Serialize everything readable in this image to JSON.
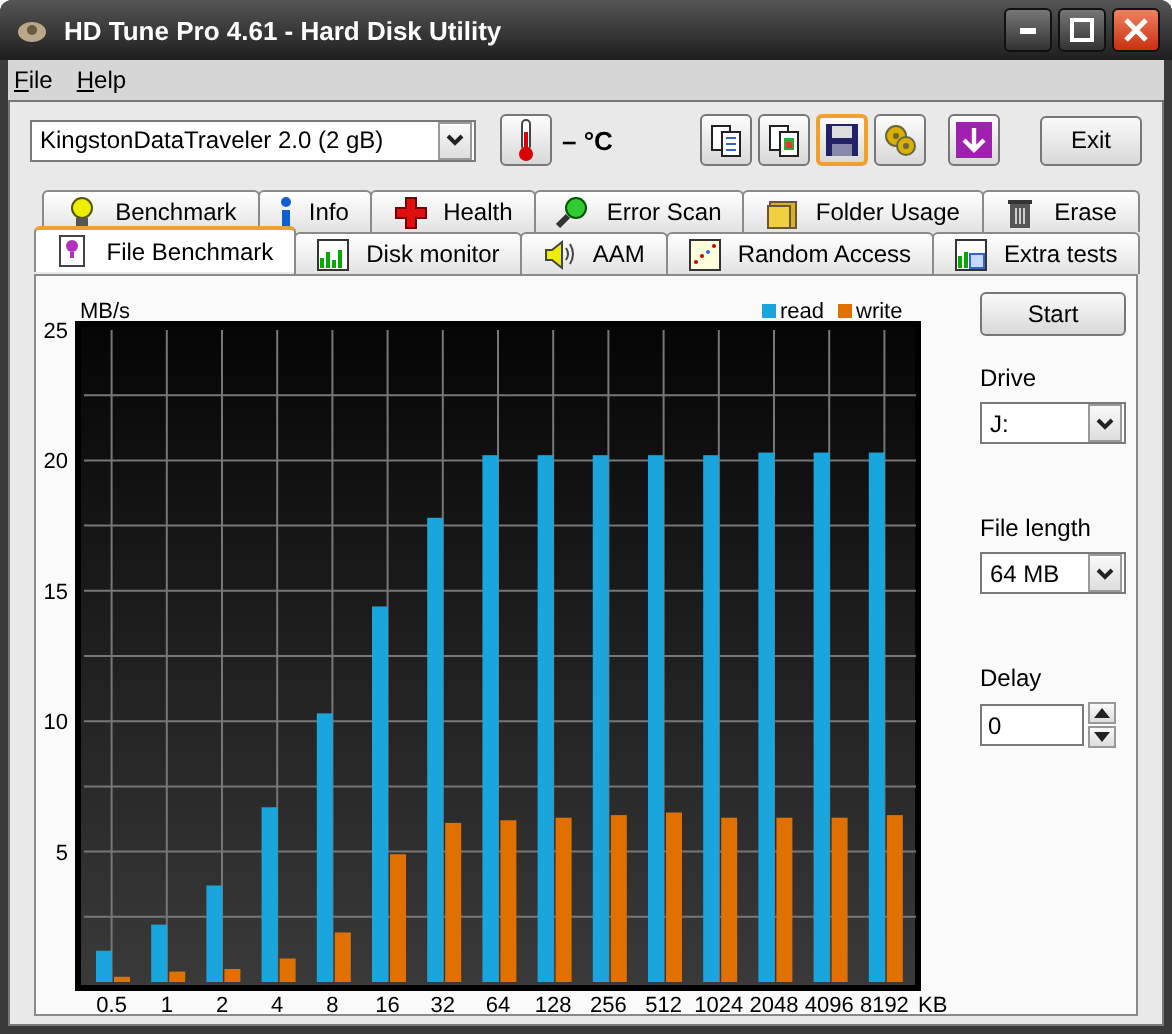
{
  "window": {
    "title": "HD Tune Pro 4.61 - Hard Disk Utility"
  },
  "menu": [
    "File",
    "Help"
  ],
  "toolbar": {
    "drive": "KingstonDataTraveler 2.0 (2 gB)",
    "temperature": "– °C",
    "exit": "Exit"
  },
  "tabs_top": [
    {
      "label": "Benchmark",
      "selected": false
    },
    {
      "label": "Info",
      "selected": false
    },
    {
      "label": "Health",
      "selected": false
    },
    {
      "label": "Error Scan",
      "selected": false
    },
    {
      "label": "Folder Usage",
      "selected": false
    },
    {
      "label": "Erase",
      "selected": false
    }
  ],
  "tabs_bottom": [
    {
      "label": "File Benchmark",
      "selected": true
    },
    {
      "label": "Disk monitor",
      "selected": false
    },
    {
      "label": "AAM",
      "selected": false
    },
    {
      "label": "Random Access",
      "selected": false
    },
    {
      "label": "Extra tests",
      "selected": false
    }
  ],
  "chart": {
    "chart_data": {
      "type": "bar",
      "ylabel": "MB/s",
      "xlabel": "KB",
      "categories": [
        "0.5",
        "1",
        "2",
        "4",
        "8",
        "16",
        "32",
        "64",
        "128",
        "256",
        "512",
        "1024",
        "2048",
        "4096",
        "8192"
      ],
      "series": [
        {
          "name": "read",
          "color": "#1aa6dc",
          "values": [
            1.2,
            2.2,
            3.7,
            6.7,
            10.3,
            14.4,
            17.8,
            20.2,
            20.2,
            20.2,
            20.2,
            20.2,
            20.3,
            20.3,
            20.3
          ]
        },
        {
          "name": "write",
          "color": "#e07000",
          "values": [
            0.2,
            0.4,
            0.5,
            0.9,
            1.9,
            4.9,
            6.1,
            6.2,
            6.3,
            6.4,
            6.5,
            6.3,
            6.3,
            6.3,
            6.4
          ]
        }
      ],
      "ylim": [
        0,
        25
      ],
      "yticks": [
        5,
        10,
        15,
        20,
        25
      ],
      "grid": true,
      "legend": true
    }
  },
  "controls": {
    "start": "Start",
    "drive_label": "Drive",
    "drive": "J:",
    "file_length_label": "File length",
    "file_length": "64 MB",
    "delay_label": "Delay",
    "delay": "0"
  }
}
